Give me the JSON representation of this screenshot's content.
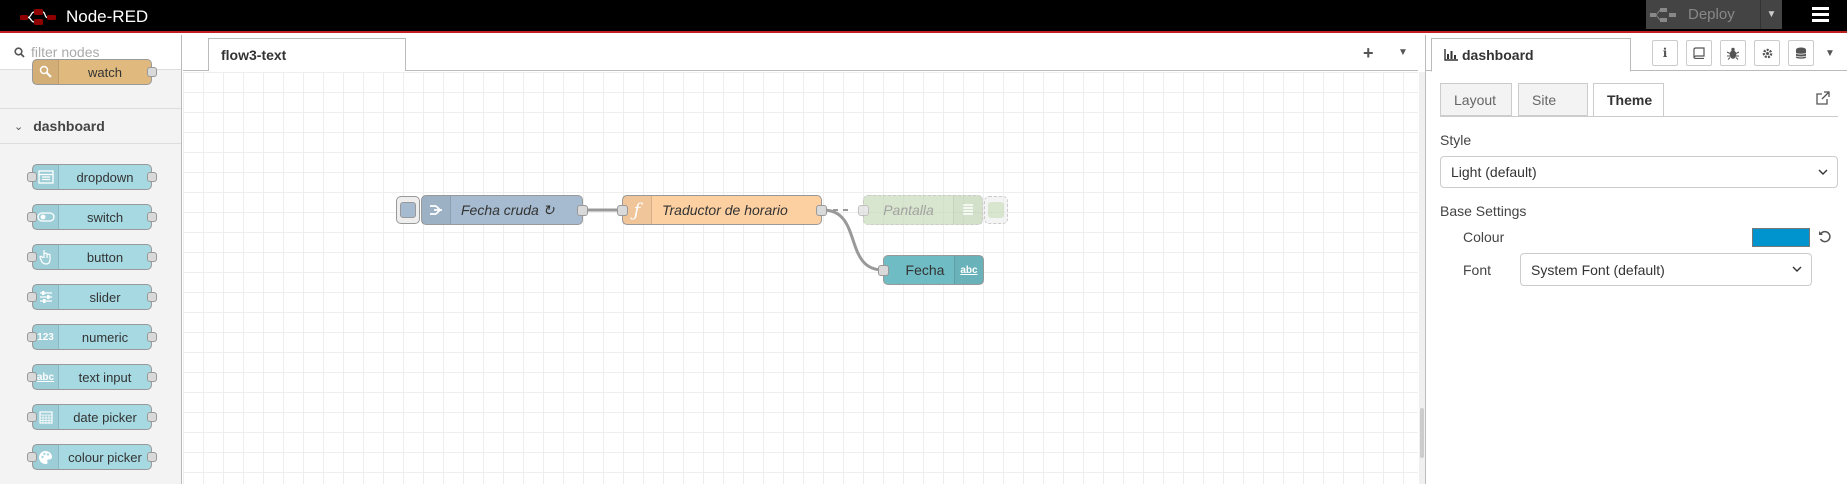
{
  "app": {
    "title": "Node-RED"
  },
  "header": {
    "deploy_label": "Deploy"
  },
  "palette": {
    "search_placeholder": "filter nodes",
    "partial_node": {
      "label": "watch",
      "color": "#dfb97e"
    },
    "category": "dashboard",
    "nodes": [
      {
        "label": "dropdown",
        "icon": "dropdown-icon"
      },
      {
        "label": "switch",
        "icon": "switch-toggle-icon"
      },
      {
        "label": "button",
        "icon": "hand-pointer-icon"
      },
      {
        "label": "slider",
        "icon": "sliders-icon"
      },
      {
        "label": "numeric",
        "icon": "numeric-123-icon",
        "icon_text": "123"
      },
      {
        "label": "text input",
        "icon": "text-abc-icon",
        "icon_text": "abc"
      },
      {
        "label": "date picker",
        "icon": "calendar-icon"
      },
      {
        "label": "colour picker",
        "icon": "palette-icon"
      }
    ],
    "node_color": "#a6d9e2"
  },
  "workspace": {
    "tab_label": "flow3-text",
    "nodes": [
      {
        "id": "fecha-cruda",
        "label": "Fecha cruda",
        "suffix": "↻",
        "color": "#a6bbcf",
        "icon": "inject-arrow-icon"
      },
      {
        "id": "traductor",
        "label": "Traductor de horario",
        "color": "#fdd0a2",
        "icon": "function-icon"
      },
      {
        "id": "pantalla",
        "label": "Pantalla",
        "color": "#c0d7b0",
        "icon": "list-icon",
        "disabled": true
      },
      {
        "id": "fecha",
        "label": "Fecha",
        "color": "#6fbcc4",
        "icon": "text-abc-icon",
        "icon_text": "abc"
      }
    ]
  },
  "sidebar": {
    "tab_label": "dashboard",
    "sub_tabs": [
      "Layout",
      "Site",
      "Theme"
    ],
    "active_sub_tab": "Theme",
    "style_label": "Style",
    "style_value": "Light (default)",
    "base_settings_label": "Base Settings",
    "colour_label": "Colour",
    "colour_value": "#0094ce",
    "font_label": "Font",
    "font_value": "System Font (default)"
  }
}
